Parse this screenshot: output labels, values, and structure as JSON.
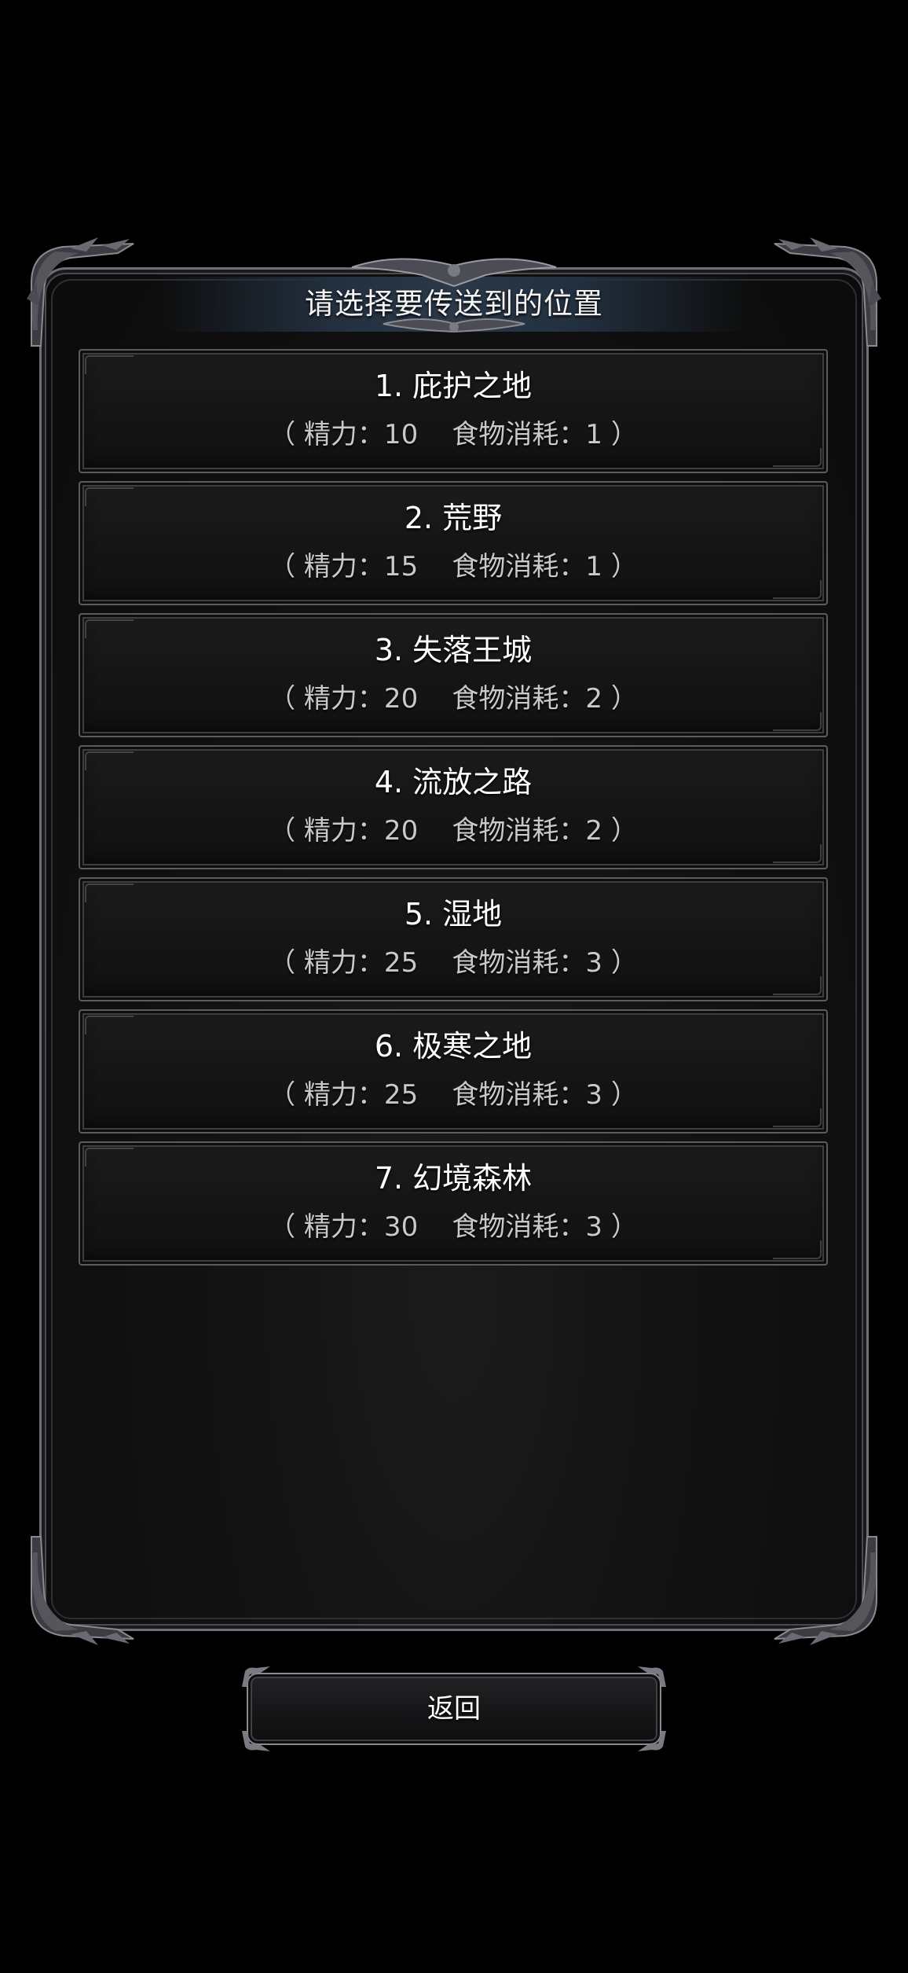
{
  "dialog": {
    "title": "请选择要传送到的位置"
  },
  "locations": [
    {
      "name": "1. 庇护之地",
      "stats": "（ 精力：10    食物消耗：1 ）"
    },
    {
      "name": "2. 荒野",
      "stats": "（ 精力：15    食物消耗：1 ）"
    },
    {
      "name": "3. 失落王城",
      "stats": "（ 精力：20    食物消耗：2 ）"
    },
    {
      "name": "4. 流放之路",
      "stats": "（ 精力：20    食物消耗：2 ）"
    },
    {
      "name": "5. 湿地",
      "stats": "（ 精力：25    食物消耗：3 ）"
    },
    {
      "name": "6. 极寒之地",
      "stats": "（ 精力：25    食物消耗：3 ）"
    },
    {
      "name": "7. 幻境森林",
      "stats": "（ 精力：30    食物消耗：3 ）"
    }
  ],
  "footer": {
    "back_label": "返回"
  },
  "colors": {
    "background": "#000000",
    "panel_border": "#6f6f74",
    "title_bar": "#2a3848",
    "text_primary": "#ffffff",
    "text_secondary": "#c9c9c9"
  }
}
